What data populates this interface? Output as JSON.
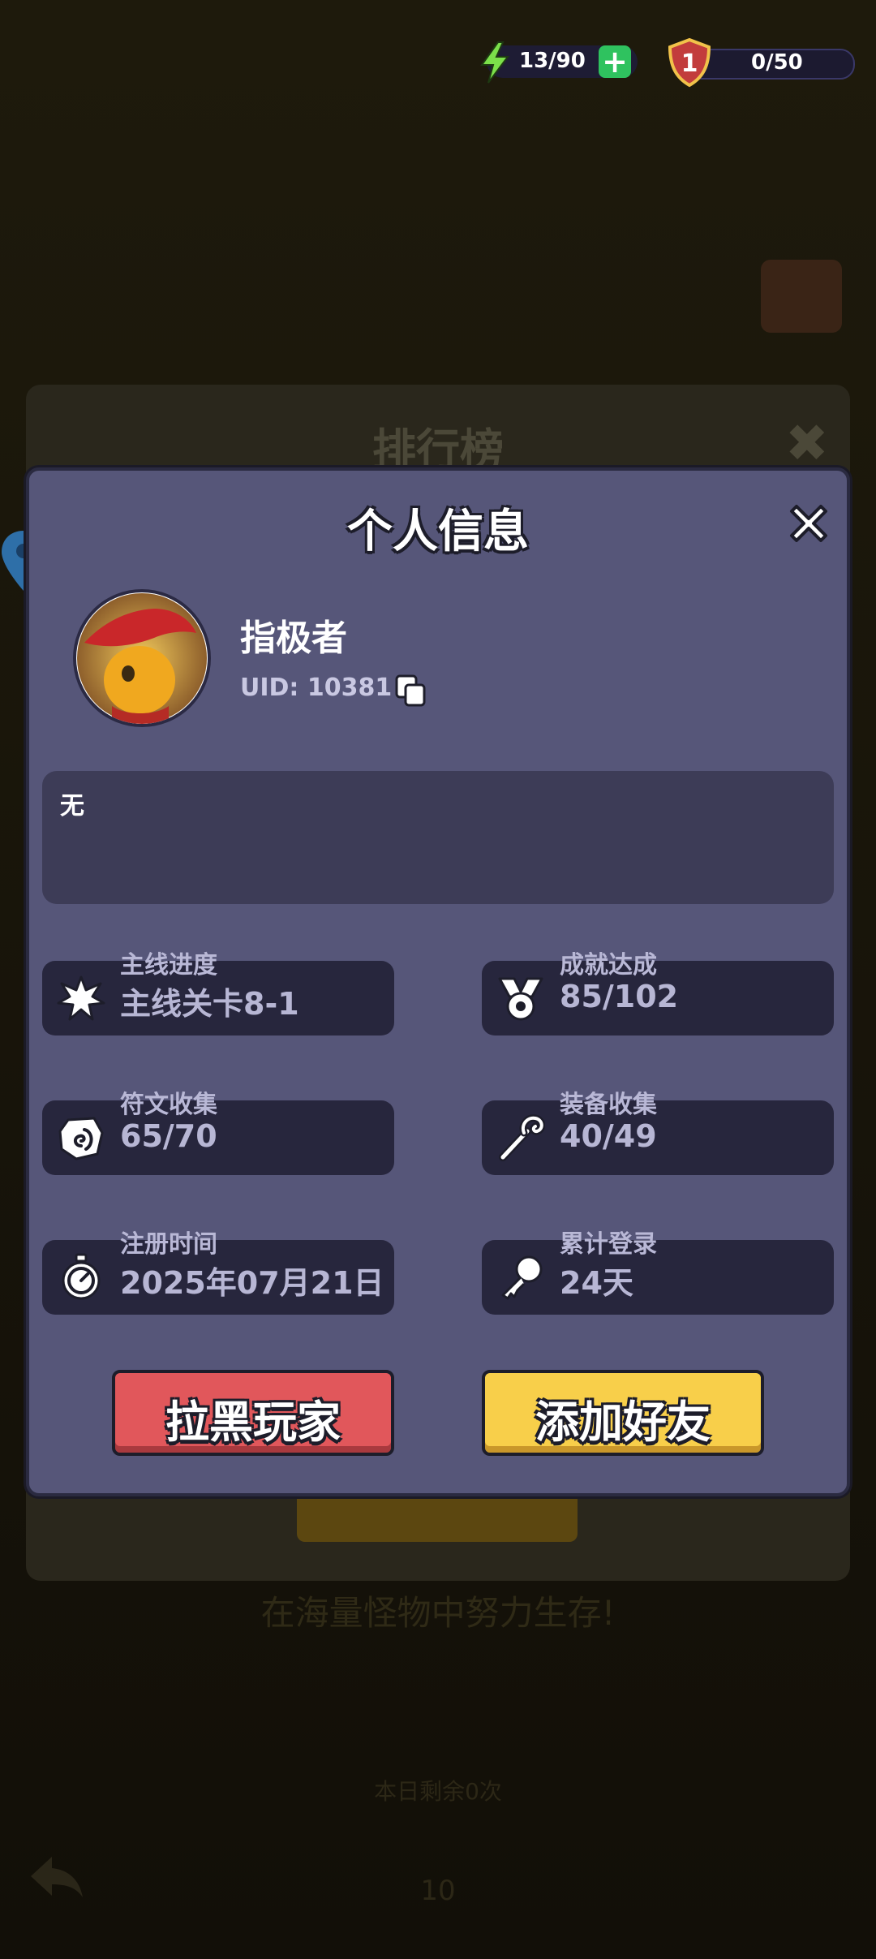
{
  "hud": {
    "energy": "13/90",
    "energy_plus": "+",
    "rank_level": "1",
    "rank_progress": "0/50"
  },
  "background": {
    "tagline": "在海量怪物中努力生存!",
    "remaining": "本日剩余0次",
    "cost": "10"
  },
  "leaderboard": {
    "title": "排行榜"
  },
  "dialog": {
    "title": "个人信息",
    "player": {
      "name": "指极者",
      "uid": "UID: 10381"
    },
    "bio": "无",
    "stats": [
      {
        "label": "主线进度",
        "value": "主线关卡8-1",
        "icon": "starburst-icon"
      },
      {
        "label": "成就达成",
        "value": "85/102",
        "icon": "medal-icon"
      },
      {
        "label": "符文收集",
        "value": "65/70",
        "icon": "rune-stone-icon"
      },
      {
        "label": "装备收集",
        "value": "40/49",
        "icon": "staff-icon"
      },
      {
        "label": "注册时间",
        "value": "2025年07月21日",
        "icon": "stopwatch-icon"
      },
      {
        "label": "累计登录",
        "value": "24天",
        "icon": "key-icon"
      }
    ],
    "buttons": {
      "block": "拉黑玩家",
      "add_friend": "添加好友"
    }
  },
  "colors": {
    "dialog_bg": "#565679",
    "stat_bg": "#27263d",
    "block_button": "#e1575b",
    "friend_button": "#f8cf4a"
  }
}
